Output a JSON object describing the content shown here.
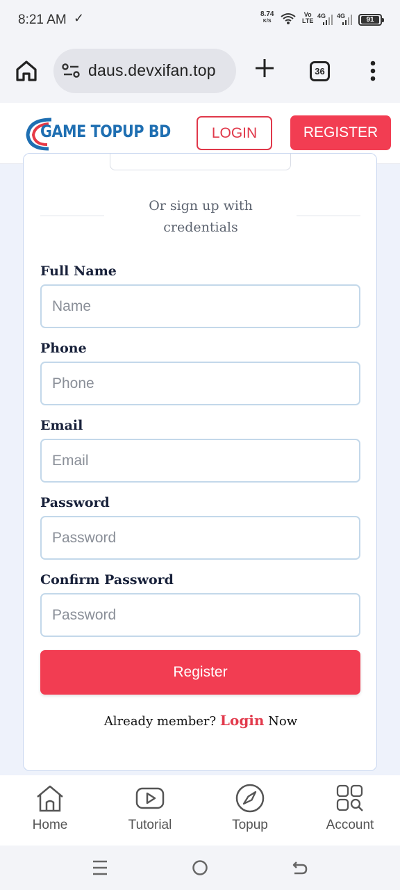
{
  "status_bar": {
    "time": "8:21 AM",
    "check_glyph": "✓",
    "net_speed": "8.74",
    "net_unit": "K/S",
    "volte_top": "Vo",
    "volte_bottom": "LTE",
    "sig1": "4G",
    "sig2": "4G",
    "battery": "91"
  },
  "browser": {
    "url": "daus.devxifan.top",
    "tab_count": "36"
  },
  "site_header": {
    "logo_part1": "GAME TOPUP ",
    "logo_part2": "BD",
    "login_label": "LOGIN",
    "register_label": "REGISTER"
  },
  "form": {
    "or_text": "Or sign up with credentials",
    "fields": [
      {
        "label": "Full Name",
        "placeholder": "Name",
        "value": ""
      },
      {
        "label": "Phone",
        "placeholder": "Phone",
        "value": ""
      },
      {
        "label": "Email",
        "placeholder": "Email",
        "value": ""
      },
      {
        "label": "Password",
        "placeholder": "Password",
        "value": ""
      },
      {
        "label": "Confirm Password",
        "placeholder": "Password",
        "value": ""
      }
    ],
    "submit_label": "Register",
    "already_prefix": "Already member? ",
    "already_link": "Login",
    "already_suffix": " Now"
  },
  "bottom_nav": [
    {
      "label": "Home",
      "icon": "house-icon"
    },
    {
      "label": "Tutorial",
      "icon": "youtube-icon"
    },
    {
      "label": "Topup",
      "icon": "compass-icon"
    },
    {
      "label": "Account",
      "icon": "grid-search-icon"
    }
  ],
  "colors": {
    "accent_red": "#f23d52",
    "logo_blue": "#1f6fb2",
    "label_dark": "#18213a",
    "input_border": "#c3d8ea"
  }
}
